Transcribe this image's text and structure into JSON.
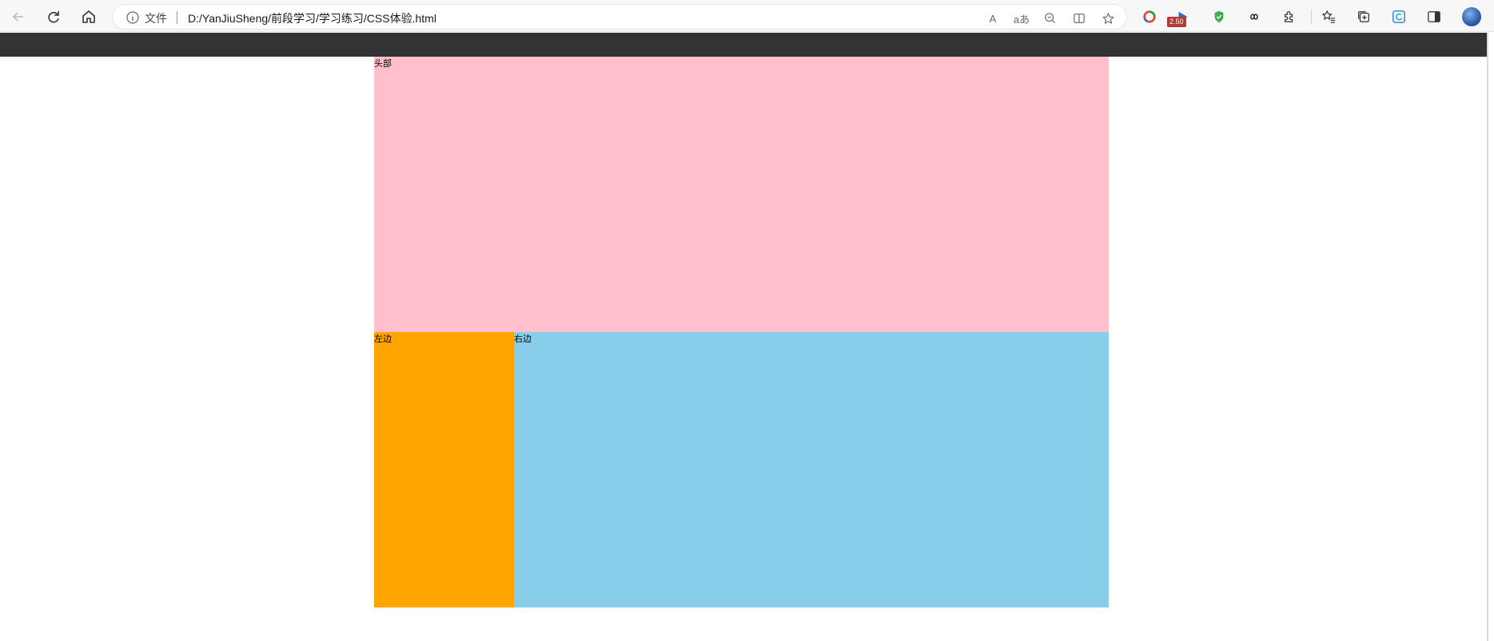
{
  "browser": {
    "address_label": "文件",
    "url": "D:/YanJiuSheng/前段学习/学习练习/CSS体验.html",
    "read_aloud_label": "A",
    "translate_label": "aあ",
    "extension_badge": "2.50",
    "icons": {
      "back": "back-arrow-icon",
      "refresh": "refresh-icon",
      "home": "home-icon",
      "info": "info-icon",
      "zoom_out": "zoom-out-icon",
      "split_screen": "split-screen-icon",
      "add_favorite": "add-favorite-icon",
      "extensions": "puzzle-icon",
      "favorites": "favorites-icon",
      "collections": "collections-icon",
      "edge": "edge-icon",
      "sidebar": "sidebar-icon",
      "profile": "profile-avatar"
    }
  },
  "page": {
    "colors": {
      "topbar": "#333333",
      "header": "#ffc0cb",
      "left": "#ffa500",
      "right": "#87ceeb"
    },
    "header_text": "头部",
    "left_text": "左边",
    "right_text": "右边"
  }
}
